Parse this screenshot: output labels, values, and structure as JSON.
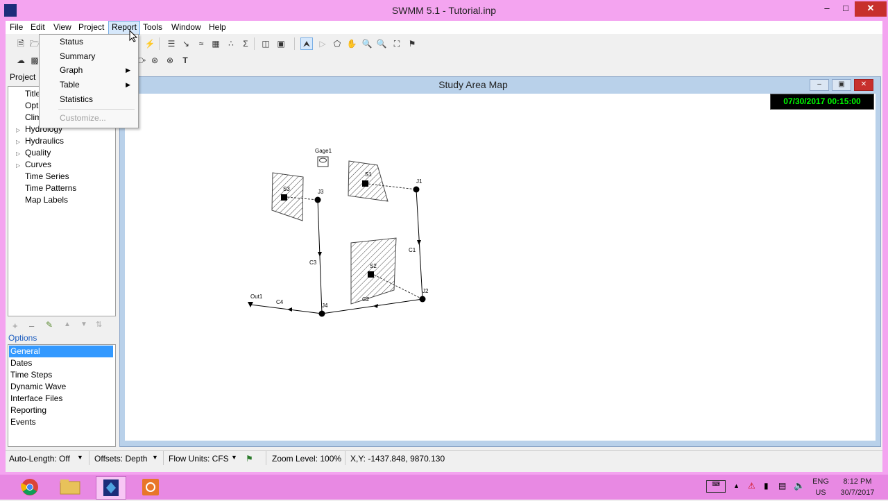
{
  "window": {
    "title": "SWMM 5.1 - Tutorial.inp"
  },
  "menubar": [
    {
      "label": "File"
    },
    {
      "label": "Edit"
    },
    {
      "label": "View"
    },
    {
      "label": "Project"
    },
    {
      "label": "Report"
    },
    {
      "label": "Tools"
    },
    {
      "label": "Window"
    },
    {
      "label": "Help"
    }
  ],
  "report_menu": {
    "items": [
      {
        "label": "Status",
        "submenu": false,
        "enabled": true
      },
      {
        "label": "Summary",
        "submenu": false,
        "enabled": true
      },
      {
        "label": "Graph",
        "submenu": true,
        "enabled": true
      },
      {
        "label": "Table",
        "submenu": true,
        "enabled": true
      },
      {
        "label": "Statistics",
        "submenu": false,
        "enabled": true
      },
      {
        "label": "Customize...",
        "submenu": false,
        "enabled": false
      }
    ]
  },
  "left_panel": {
    "tab": "Project",
    "tree": [
      "Title",
      "Opt",
      "Clim",
      "Hydrology",
      "Hydraulics",
      "Quality",
      "Curves",
      "Time Series",
      "Time Patterns",
      "Map Labels"
    ],
    "options_label": "Options",
    "options": [
      "General",
      "Dates",
      "Time Steps",
      "Dynamic Wave",
      "Interface Files",
      "Reporting",
      "Events"
    ],
    "selected_option": "General"
  },
  "map_window": {
    "title": "Study Area Map",
    "datetime": "07/30/2017 00:15:00",
    "labels": {
      "gage": "Gage1",
      "subcatchments": [
        "S1",
        "S2",
        "S3"
      ],
      "junctions": [
        "J1",
        "J2",
        "J3",
        "J4"
      ],
      "outfall": "Out1",
      "conduits": [
        "C1",
        "C2",
        "C3",
        "C4"
      ]
    }
  },
  "statusbar": {
    "auto_length": "Auto-Length: Off",
    "offsets": "Offsets: Depth",
    "flow_units": "Flow Units: CFS",
    "zoom": "Zoom Level: 100%",
    "xy": "X,Y: -1437.848, 9870.130"
  },
  "taskbar": {
    "lang": "ENG",
    "region": "US",
    "time": "8:12 PM",
    "date": "30/7/2017"
  },
  "colors": {
    "frame": "#f4a4f0",
    "taskbar": "#e889e3",
    "selection": "#3399ff",
    "clock_text": "#00ff00"
  }
}
